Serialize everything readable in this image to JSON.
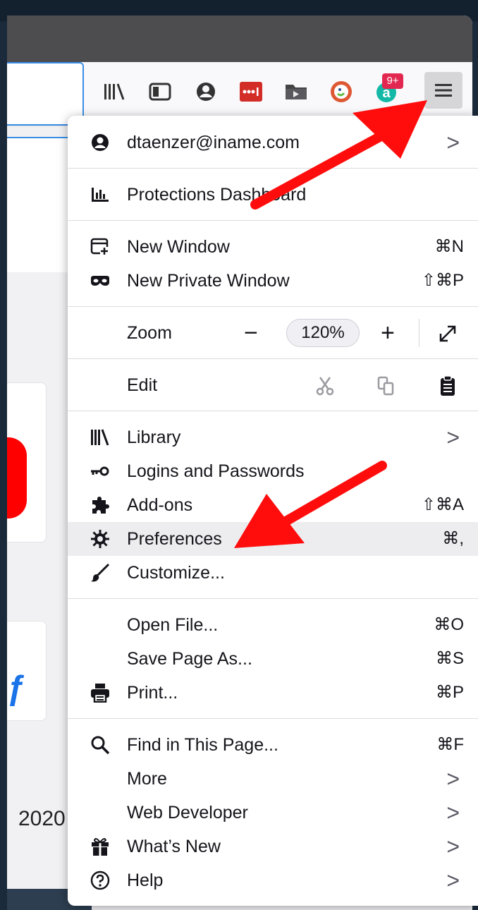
{
  "toolbar": {
    "icons": [
      "library-icon",
      "sidebar-icon",
      "account-icon",
      "lastpass-icon",
      "downloads-folder-icon",
      "duckduckgo-icon",
      "amazon-assistant-icon",
      "hamburger-menu-icon"
    ],
    "badge": "9+"
  },
  "page": {
    "visible_text": "2020"
  },
  "menu": {
    "account": {
      "label": "dtaenzer@iname.com",
      "chevron": ">"
    },
    "protections": {
      "label": "Protections Dashboard"
    },
    "new_window": {
      "label": "New Window",
      "shortcut": "⌘N"
    },
    "new_private_window": {
      "label": "New Private Window",
      "shortcut": "⇧⌘P"
    },
    "zoom": {
      "label": "Zoom",
      "minus": "−",
      "value": "120%",
      "plus": "+"
    },
    "edit": {
      "label": "Edit"
    },
    "library": {
      "label": "Library",
      "chevron": ">"
    },
    "logins": {
      "label": "Logins and Passwords"
    },
    "addons": {
      "label": "Add-ons",
      "shortcut": "⇧⌘A"
    },
    "preferences": {
      "label": "Preferences",
      "shortcut": "⌘,"
    },
    "customize": {
      "label": "Customize..."
    },
    "open_file": {
      "label": "Open File...",
      "shortcut": "⌘O"
    },
    "save_page": {
      "label": "Save Page As...",
      "shortcut": "⌘S"
    },
    "print": {
      "label": "Print...",
      "shortcut": "⌘P"
    },
    "find": {
      "label": "Find in This Page...",
      "shortcut": "⌘F"
    },
    "more": {
      "label": "More",
      "chevron": ">"
    },
    "web_developer": {
      "label": "Web Developer",
      "chevron": ">"
    },
    "whats_new": {
      "label": "What’s New",
      "chevron": ">"
    },
    "help": {
      "label": "Help",
      "chevron": ">"
    }
  },
  "colors": {
    "annotation_arrow": "#ff0d0d",
    "highlight_row": "#ededf0",
    "focus_ring": "#3a8ee6"
  }
}
